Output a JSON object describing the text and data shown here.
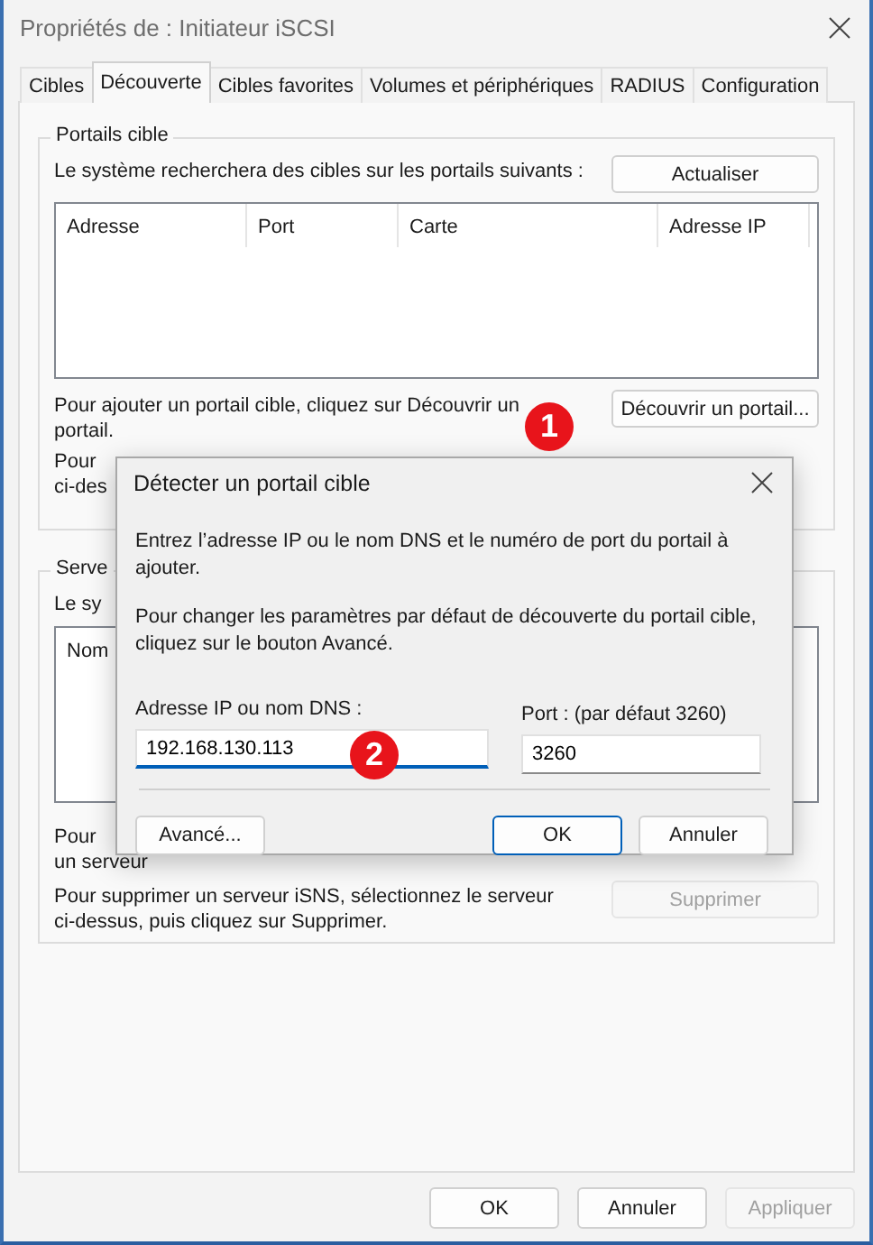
{
  "window": {
    "title": "Propriétés de : Initiateur iSCSI"
  },
  "tabs": [
    {
      "label": "Cibles",
      "selected": false
    },
    {
      "label": "Découverte",
      "selected": true
    },
    {
      "label": "Cibles favorites",
      "selected": false
    },
    {
      "label": "Volumes et périphériques",
      "selected": false
    },
    {
      "label": "RADIUS",
      "selected": false
    },
    {
      "label": "Configuration",
      "selected": false
    }
  ],
  "target_portals": {
    "legend": "Portails cible",
    "description": "Le système recherchera des cibles sur les portails suivants :",
    "refresh_button": "Actualiser",
    "columns": [
      "Adresse",
      "Port",
      "Carte",
      "Adresse IP"
    ],
    "add_text": "Pour ajouter un portail cible, cliquez sur Découvrir un portail.",
    "discover_button": "Découvrir un portail...",
    "remove_text_lines": [
      "Pour",
      "ci-des"
    ]
  },
  "isns_servers": {
    "legend": "Serve",
    "description": "Le sy",
    "columns": [
      "Nom"
    ],
    "add_text_lines": [
      "Pour",
      "un serveur"
    ],
    "remove_text": "Pour supprimer un serveur iSNS, sélectionnez le serveur ci-dessus, puis cliquez sur Supprimer.",
    "remove_button": {
      "label": "Supprimer",
      "disabled": true
    }
  },
  "buttons": [
    {
      "label": "OK",
      "disabled": false
    },
    {
      "label": "Annuler",
      "disabled": false
    },
    {
      "label": "Appliquer",
      "disabled": true
    }
  ],
  "dialog": {
    "title": "Détecter un portail cible",
    "intro": "Entrez l’adresse IP ou le nom DNS et le numéro de port du portail à ajouter.",
    "hint": "Pour changer les paramètres par défaut de découverte du portail cible, cliquez sur le bouton Avancé.",
    "address": {
      "label": "Adresse IP ou nom DNS :",
      "value": "192.168.130.113",
      "focused": true
    },
    "port": {
      "label": "Port : (par défaut 3260)",
      "value": "3260",
      "focused": false
    },
    "buttons": [
      {
        "label": "Avancé...",
        "default": false
      },
      {
        "label": "OK",
        "default": true
      },
      {
        "label": "Annuler",
        "default": false
      }
    ]
  },
  "markers": [
    "1",
    "2"
  ]
}
